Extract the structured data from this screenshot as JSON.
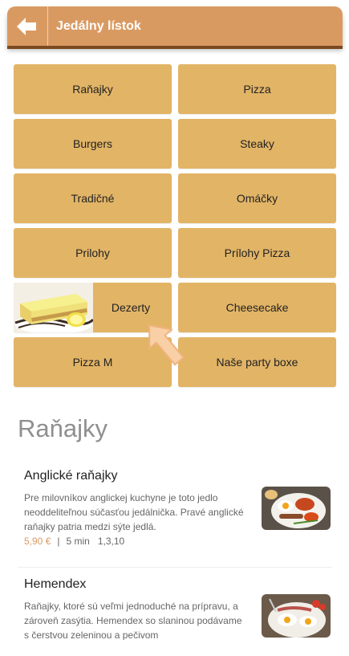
{
  "header": {
    "title": "Jedálny lístok",
    "back_icon": "arrow-left-icon",
    "color": "#d99a62"
  },
  "categories": [
    {
      "label": "Raňajky"
    },
    {
      "label": "Pizza"
    },
    {
      "label": "Burgers"
    },
    {
      "label": "Steaky"
    },
    {
      "label": "Tradičné"
    },
    {
      "label": "Omáčky"
    },
    {
      "label": "Prilohy"
    },
    {
      "label": "Prílohy Pizza"
    },
    {
      "label": "Dezerty"
    },
    {
      "label": "Cheesecake"
    },
    {
      "label": "Pizza M"
    },
    {
      "label": "Naše party boxe"
    }
  ],
  "category_color": "#e2b466",
  "section": {
    "title": "Raňajky"
  },
  "items": [
    {
      "name": "Anglické raňajky",
      "description": "Pre milovníkov anglickej kuchyne je toto jedlo neoddeliteľnou súčasťou jedálnička. Pravé anglické raňajky patria medzi sýte jedlá.",
      "price": "5,90 €",
      "separator": "|",
      "time": "5 min",
      "allergens": "1,3,10"
    },
    {
      "name": "Hemendex",
      "description": "Raňajky, ktoré sú veľmi jednoduché na prípravu, a zároveň zasýtia. Hemendex so slaninou podávame s čerstvou zeleninou a pečivom"
    }
  ]
}
